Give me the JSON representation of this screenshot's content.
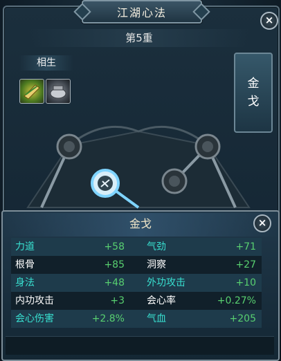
{
  "window": {
    "title": "江湖心法",
    "close_label": "×"
  },
  "tier": "第5重",
  "xiangsheng": {
    "label": "相生",
    "items": [
      "meridian-scroll-icon",
      "pot-icon"
    ]
  },
  "side_tab": {
    "char1": "金",
    "char2": "戈"
  },
  "popup": {
    "title": "金戈",
    "close_label": "×",
    "stats": [
      {
        "left_label": "力道",
        "left_value": "+58",
        "right_label": "气劲",
        "right_value": "+71",
        "highlight": true
      },
      {
        "left_label": "根骨",
        "left_value": "+85",
        "right_label": "洞察",
        "right_value": "+27",
        "highlight": false
      },
      {
        "left_label": "身法",
        "left_value": "+48",
        "right_label": "外功攻击",
        "right_value": "+10",
        "highlight": true
      },
      {
        "left_label": "内功攻击",
        "left_value": "+3",
        "right_label": "会心率",
        "right_value": "+0.27%",
        "highlight": false
      },
      {
        "left_label": "会心伤害",
        "left_value": "+2.8%",
        "right_label": "气血",
        "right_value": "+205",
        "highlight": true
      }
    ]
  },
  "colors": {
    "label_highlight": "#38e0d0",
    "value": "#58d070",
    "active_node": "#7fd4ff"
  }
}
